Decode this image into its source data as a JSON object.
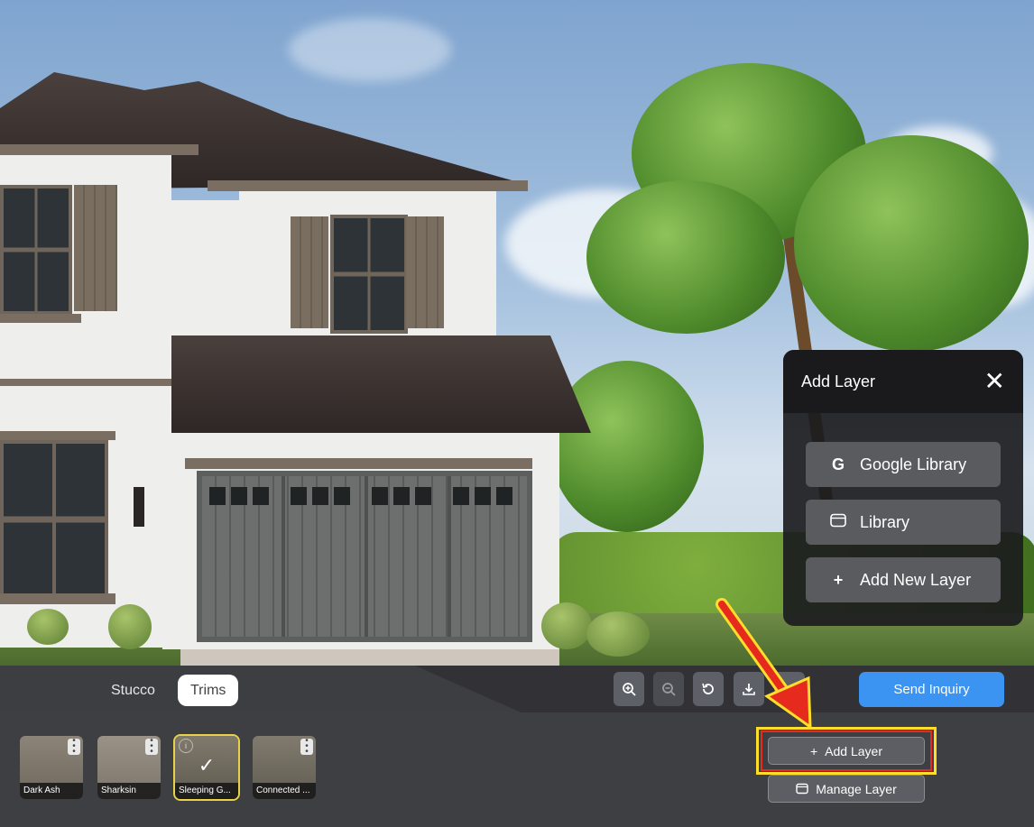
{
  "tabs": [
    {
      "label": "Stucco",
      "active": false
    },
    {
      "label": "Trims",
      "active": true
    }
  ],
  "toolbar": {
    "zoom_in_icon": "zoom-in",
    "zoom_out_icon": "zoom-out",
    "reset_icon": "rotate-ccw",
    "download_icon": "download",
    "send_label": "Send Inquiry"
  },
  "swatches": [
    {
      "name": "Dark Ash",
      "color": "#7b7468",
      "selected": false
    },
    {
      "name": "Sharksin",
      "color": "#8a8278",
      "selected": false
    },
    {
      "name": "Sleeping G...",
      "color": "#6f6a5d",
      "selected": true
    },
    {
      "name": "Connected ...",
      "color": "#706b5f",
      "selected": false
    }
  ],
  "layers": {
    "add_label": "Add Layer",
    "manage_label": "Manage Layer"
  },
  "popup": {
    "title": "Add Layer",
    "options": [
      {
        "label": "Google Library",
        "icon": "G"
      },
      {
        "label": "Library",
        "icon": "folder"
      },
      {
        "label": "Add New Layer",
        "icon": "+"
      }
    ]
  },
  "colors": {
    "accent": "#3b93f2",
    "highlight": "#ffde2b",
    "arrow": "#e62b1e"
  }
}
